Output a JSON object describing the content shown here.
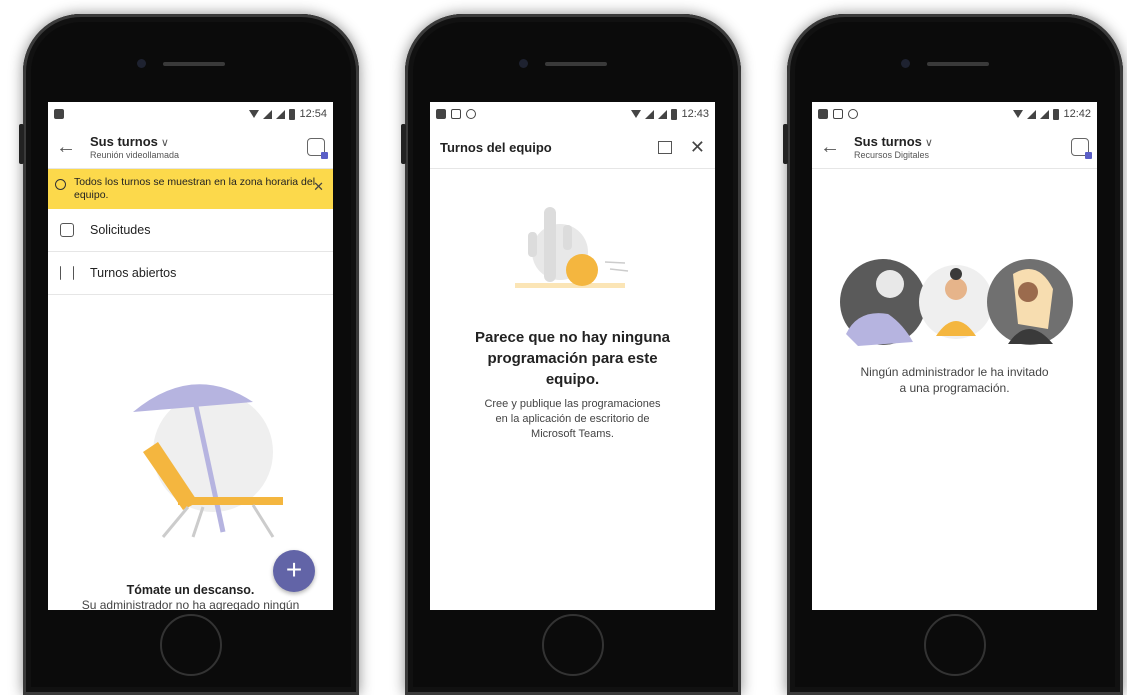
{
  "phones": {
    "p1": {
      "status_time": "12:54",
      "title": "Sus turnos",
      "subtitle": "Reunión videollamada",
      "banner": "Todos los turnos se muestran en la zona horaria del equipo.",
      "rows": [
        "Solicitudes",
        "Turnos abiertos"
      ],
      "heading": "Tómate un descanso.",
      "body": "Su administrador no ha agregado ningún",
      "fab": "+"
    },
    "p2": {
      "status_time": "12:43",
      "title": "Turnos del equipo",
      "heading_1": "Parece que no hay ninguna",
      "heading_2": "programación para este",
      "heading_3": "equipo.",
      "body_1": "Cree y publique las programaciones",
      "body_2": "en la aplicación de escritorio de",
      "body_3": "Microsoft Teams."
    },
    "p3": {
      "status_time": "12:42",
      "title": "Sus turnos",
      "subtitle": "Recursos Digitales",
      "body_1": "Ningún administrador le ha invitado",
      "body_2": "a una programación."
    }
  },
  "colors": {
    "accent": "#6264a7",
    "banner": "#fcd94b",
    "illustration_orange": "#f4b63f",
    "illustration_lilac": "#b6b4e0"
  }
}
